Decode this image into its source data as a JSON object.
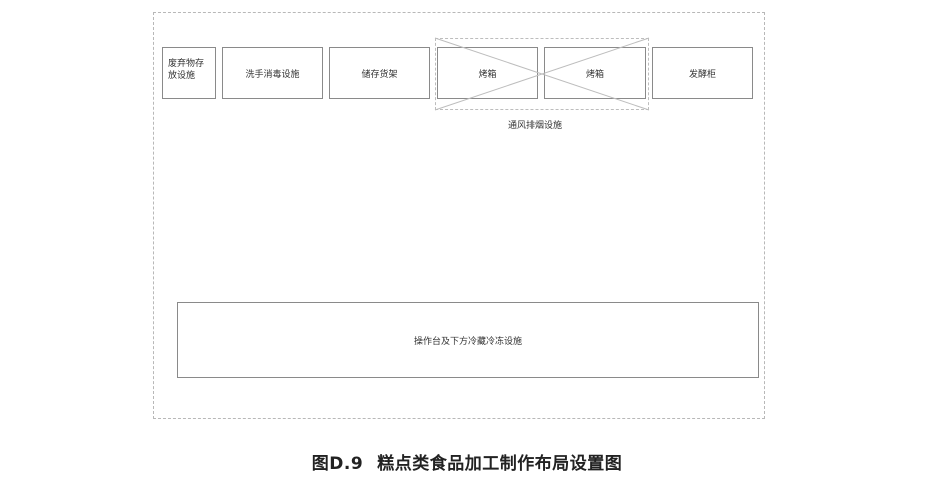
{
  "layout_diagram": {
    "stations": {
      "waste": "废弃物存放设施",
      "handwash": "洗手消毒设施",
      "storage": "储存货架",
      "oven_1": "烤箱",
      "oven_2": "烤箱",
      "proofer": "发酵柜"
    },
    "ventilation_label": "通风排烟设施",
    "workbench": "操作台及下方冷藏冷冻设施"
  },
  "caption": {
    "number": "图D.9",
    "title": "糕点类食品加工制作布局设置图"
  }
}
